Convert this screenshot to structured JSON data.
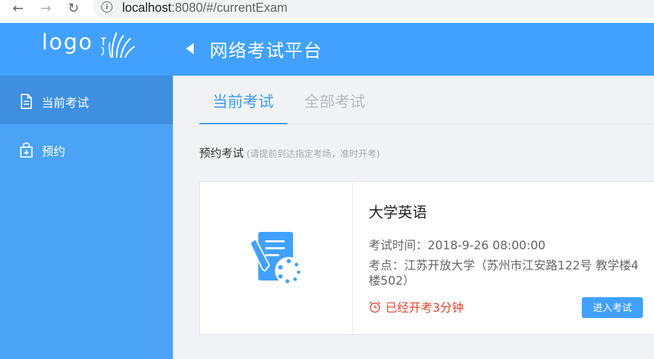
{
  "browser": {
    "url_host": "localhost",
    "url_rest": ":8080/#/currentExam"
  },
  "header": {
    "logo_text": "logo",
    "title": "网络考试平台",
    "accent_color": "#42a1ff"
  },
  "sidebar": {
    "items": [
      {
        "label": "当前考试",
        "icon": "document-icon",
        "active": true
      },
      {
        "label": "预约",
        "icon": "shopping-bag-icon",
        "active": false
      }
    ]
  },
  "tabs": [
    {
      "label": "当前考试",
      "active": true
    },
    {
      "label": "全部考试",
      "active": false
    }
  ],
  "section": {
    "title": "预约考试",
    "note": "(请提前到达指定考场，准时开考)"
  },
  "exam": {
    "name": "大学英语",
    "time": "考试时间：2018-9-26 08:00:00",
    "location": "考点：江苏开放大学（苏州市江安路122号 教学楼4楼502）",
    "status": "已经开考3分钟",
    "status_color": "#e0452f",
    "enter_label": "进入考试"
  }
}
